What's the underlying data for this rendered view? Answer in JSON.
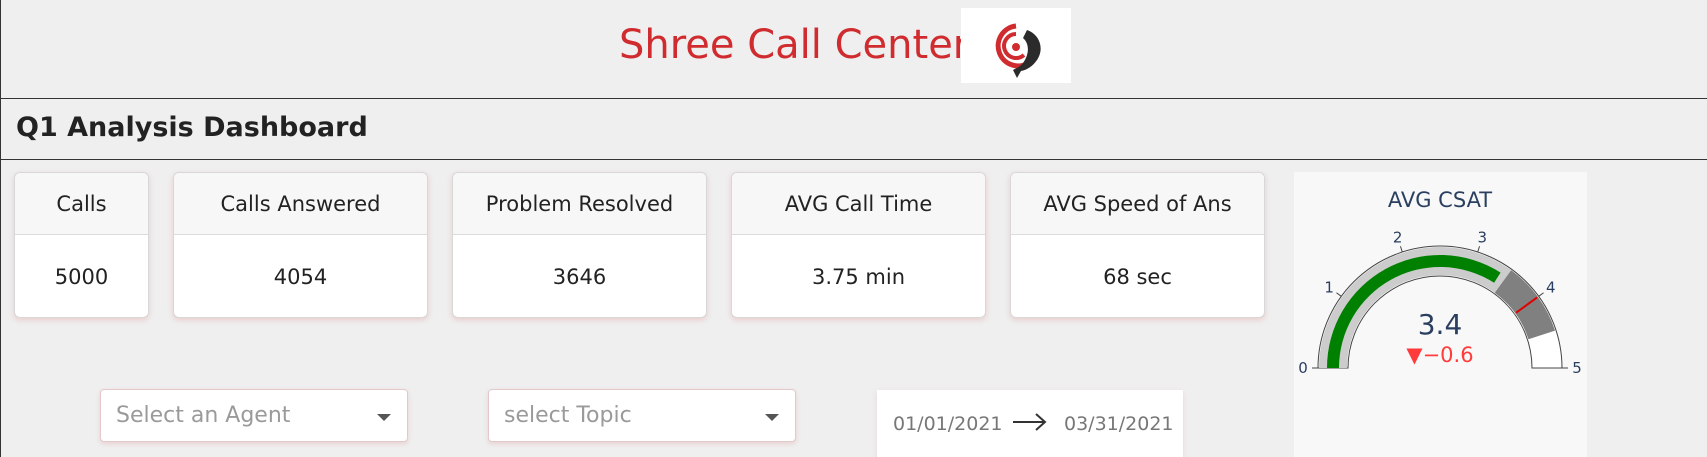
{
  "header": {
    "title": "Shree Call Center",
    "logo_icon": "phone-signal-icon",
    "brand_color": "#d02c2f"
  },
  "dashboard": {
    "subtitle": "Q1 Analysis Dashboard"
  },
  "kpis": [
    {
      "label": "Calls",
      "value": "5000"
    },
    {
      "label": "Calls Answered",
      "value": "4054"
    },
    {
      "label": "Problem Resolved",
      "value": "3646"
    },
    {
      "label": "AVG Call Time",
      "value": "3.75 min"
    },
    {
      "label": "AVG Speed of Ans",
      "value": "68 sec"
    }
  ],
  "gauge": {
    "title": "AVG CSAT",
    "value": 3.4,
    "value_label": "3.4",
    "delta_label": "▼−0.6",
    "min": 0,
    "max": 5,
    "ticks": [
      "0",
      "1",
      "2",
      "3",
      "4",
      "5"
    ],
    "threshold": 4,
    "band_start": 3.5,
    "band_end": 4.5,
    "bar_color": "#008000",
    "band_color": "#808080",
    "threshold_color": "#e00000",
    "delta_color": "#ff3b3b"
  },
  "filters": {
    "agent_placeholder": "Select an Agent",
    "topic_placeholder": "select Topic",
    "date_start": "01/01/2021",
    "date_end": "03/31/2021"
  }
}
